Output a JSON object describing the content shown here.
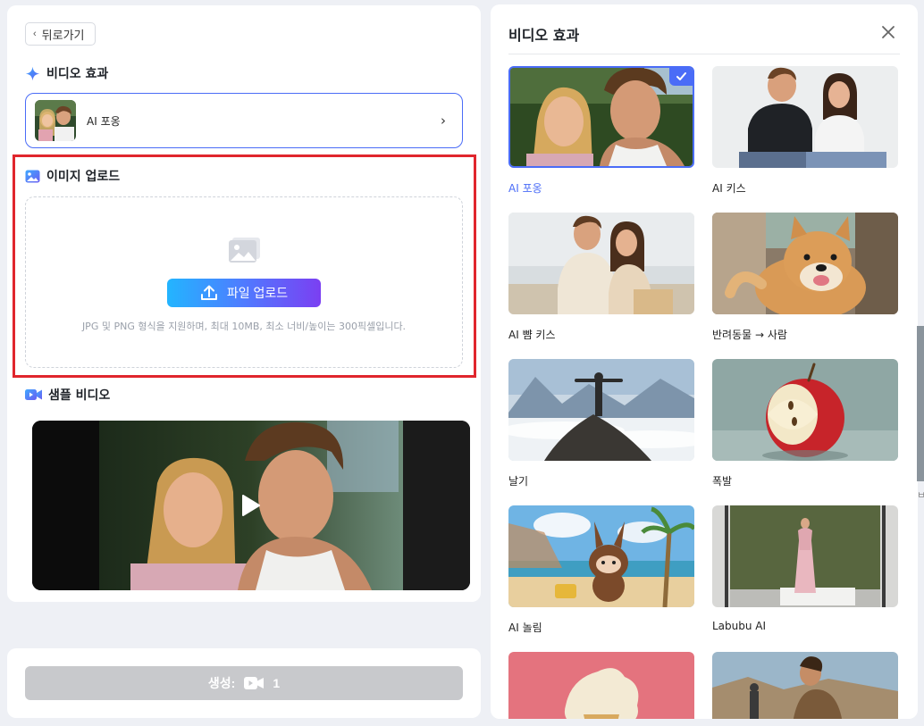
{
  "left": {
    "back_label": "뒤로가기",
    "effect_section_title": "비디오 효과",
    "selected_effect": "AI 포옹",
    "upload_section_title": "이미지 업로드",
    "upload_button": "파일 업로드",
    "upload_hint": "JPG 및 PNG 형식을 지원하며, 최대 10MB, 최소 너비/높이는 300픽셀입니다.",
    "sample_section_title": "샘플 비디오",
    "generate_label": "생성:",
    "generate_count": "1"
  },
  "right": {
    "title": "비디오 효과",
    "effects": [
      {
        "name": "AI 포옹",
        "selected": true
      },
      {
        "name": "AI 키스",
        "selected": false
      },
      {
        "name": "AI 뺨 키스",
        "selected": false
      },
      {
        "name": "반려동물 → 사람",
        "selected": false
      },
      {
        "name": "날기",
        "selected": false
      },
      {
        "name": "폭발",
        "selected": false
      },
      {
        "name": "AI 놀림",
        "selected": false
      },
      {
        "name": "Labubu AI",
        "selected": false
      }
    ]
  },
  "side_letter": "ㅂ",
  "colors": {
    "accent": "#4a6cf7",
    "highlight_border": "#e0262d",
    "upload_gradient_start": "#23b5ff",
    "upload_gradient_end": "#7b3ff2",
    "disabled_button": "#c8c9cc"
  }
}
